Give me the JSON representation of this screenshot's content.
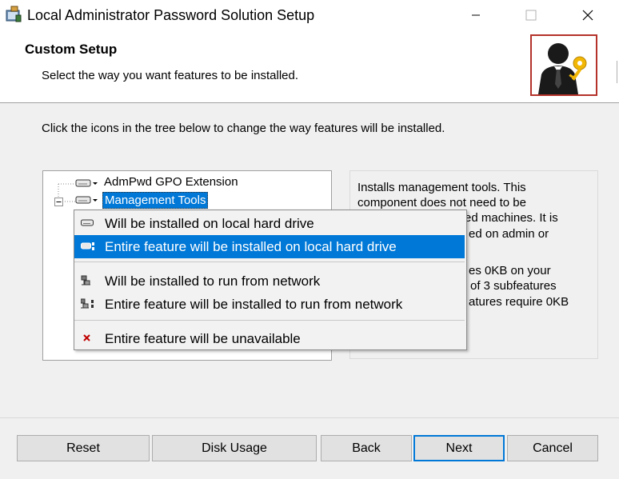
{
  "window": {
    "title": "Local Administrator Password Solution Setup"
  },
  "header": {
    "title": "Custom Setup",
    "subtitle": "Select the way you want features to be installed."
  },
  "instructions": "Click the icons in the tree below to change the way features will be installed.",
  "tree": {
    "items": [
      {
        "label": "AdmPwd GPO Extension"
      },
      {
        "label": "Management Tools"
      }
    ]
  },
  "description": {
    "lines": [
      "Installs management tools. This",
      "component does not need to be",
      "ed machines. It is",
      "ed on admin or",
      "es 0KB on your",
      "of 3 subfeatures",
      "atures require 0KB"
    ]
  },
  "menu": {
    "items": [
      {
        "label": "Will be installed on local hard drive",
        "icon": "hard-drive-icon"
      },
      {
        "label": "Entire feature will be installed on local hard drive",
        "icon": "hard-drive-entire-icon"
      },
      {
        "label": "Will be installed to run from network",
        "icon": "network-icon"
      },
      {
        "label": "Entire feature will be installed to run from network",
        "icon": "network-entire-icon"
      },
      {
        "label": "Entire feature will be unavailable",
        "icon": "unavailable-x-icon"
      }
    ],
    "selected_index": 1
  },
  "buttons": {
    "reset": "Reset",
    "disk_usage": "Disk Usage",
    "back": "Back",
    "next": "Next",
    "cancel": "Cancel"
  },
  "colors": {
    "accent": "#0078d7",
    "unavailable": "#c00000",
    "logo_border": "#b4322a",
    "key": "#f2b705"
  }
}
